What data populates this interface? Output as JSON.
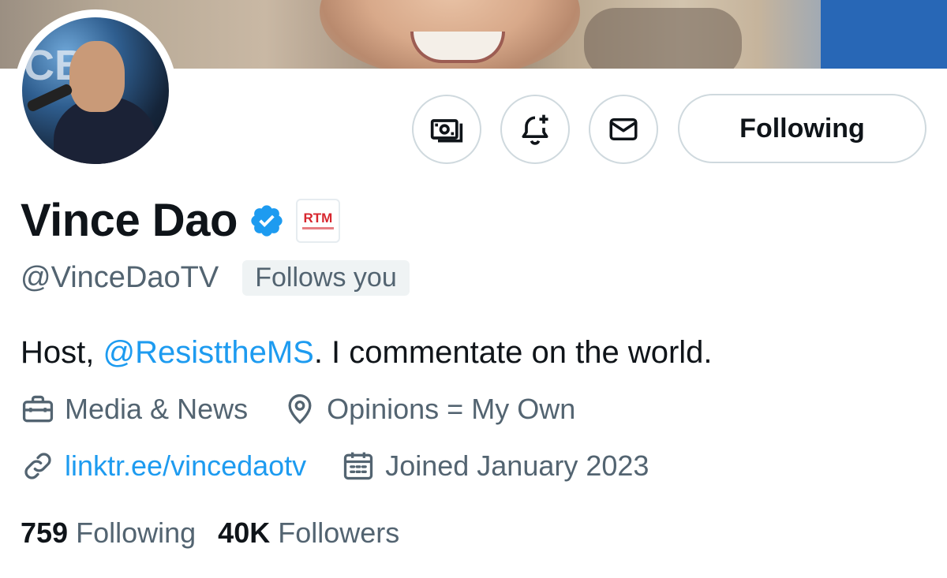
{
  "profile": {
    "name": "Vince Dao",
    "handle": "@VinceDaoTV",
    "follows_you": "Follows you",
    "affiliate_badge": "RTM",
    "bio_prefix": "Host, ",
    "bio_mention": "@ResisttheMS",
    "bio_suffix": ". I commentate on the world.",
    "category": "Media & News",
    "location": "Opinions = My Own",
    "website": "linktr.ee/vincedaotv",
    "joined": "Joined January 2023",
    "following_count": "759",
    "following_label": "Following",
    "followers_count": "40K",
    "followers_label": "Followers"
  },
  "actions": {
    "tip_icon": "money-icon",
    "notify_icon": "bell-plus-icon",
    "message_icon": "envelope-icon",
    "follow_state_label": "Following"
  },
  "colors": {
    "accent": "#1d9bf0",
    "text": "#0f1419",
    "muted": "#536471",
    "border": "#cfd9de",
    "affiliate": "#d7262e"
  }
}
